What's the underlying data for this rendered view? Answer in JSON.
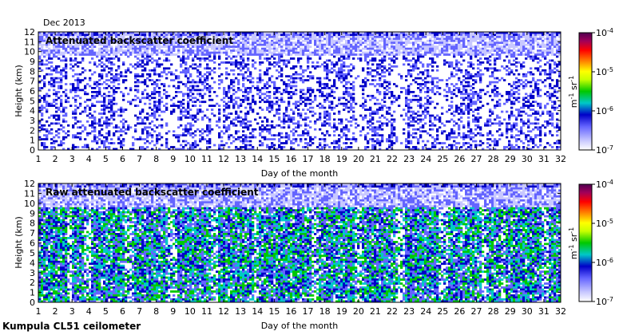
{
  "figure": {
    "date_label": "Dec 2013",
    "footer": "Kumpula CL51 ceilometer"
  },
  "colorbar_ticks": [
    "10-7",
    "10-6",
    "10-5",
    "10-4"
  ],
  "colorbar_unit": "m-1 sr-1",
  "colormap": [
    "#ffffff",
    "#c8c8ff",
    "#6464ff",
    "#0000c8",
    "#00c8c8",
    "#00c800",
    "#c8ff00",
    "#ffff00",
    "#ff8c00",
    "#ff0000",
    "#a0005a",
    "#500050"
  ],
  "chart_data": [
    {
      "type": "heatmap",
      "title": "Attenuated backscatter coefficient",
      "xlabel": "Day of the month",
      "ylabel": "Height (km)",
      "xlim": [
        1,
        32
      ],
      "ylim": [
        0,
        12
      ],
      "x_ticks": [
        1,
        2,
        3,
        4,
        5,
        6,
        7,
        8,
        9,
        10,
        11,
        12,
        13,
        14,
        15,
        16,
        17,
        18,
        19,
        20,
        21,
        22,
        23,
        24,
        25,
        26,
        27,
        28,
        29,
        30,
        31,
        32
      ],
      "y_ticks": [
        0,
        1,
        2,
        3,
        4,
        5,
        6,
        7,
        8,
        9,
        10,
        11,
        12
      ],
      "color_scale": "log",
      "color_range": [
        1e-07,
        0.0001
      ],
      "grid": false
    },
    {
      "type": "heatmap",
      "title": "Raw attenuated backscatter coefficient",
      "xlabel": "Day of the month",
      "ylabel": "Height (km)",
      "xlim": [
        1,
        32
      ],
      "ylim": [
        0,
        12
      ],
      "x_ticks": [
        1,
        2,
        3,
        4,
        5,
        6,
        7,
        8,
        9,
        10,
        11,
        12,
        13,
        14,
        15,
        16,
        17,
        18,
        19,
        20,
        21,
        22,
        23,
        24,
        25,
        26,
        27,
        28,
        29,
        30,
        31,
        32
      ],
      "y_ticks": [
        0,
        1,
        2,
        3,
        4,
        5,
        6,
        7,
        8,
        9,
        10,
        11,
        12
      ],
      "color_scale": "log",
      "color_range": [
        1e-07,
        0.0001
      ],
      "grid": false
    }
  ]
}
